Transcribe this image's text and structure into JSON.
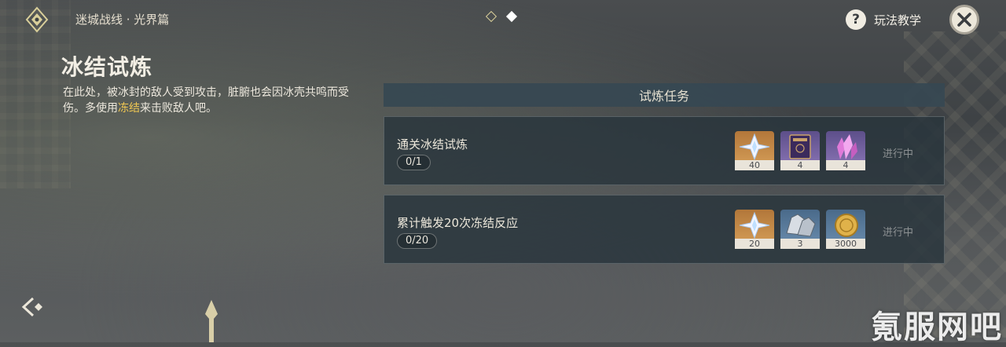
{
  "header": {
    "logo_icon": "diamond-emblem-icon",
    "breadcrumb": "迷城战线 · 光界篇",
    "pager": {
      "count": 2,
      "active": 2
    },
    "help_label": "玩法教学",
    "close_icon": "close-icon"
  },
  "info": {
    "title": "冰结试炼",
    "desc_before": "在此处，被冰封的敌人受到攻击，脏腑也会因冰壳共鸣而受伤。多使用",
    "desc_highlight": "冻结",
    "desc_after": "来击败敌人吧。",
    "highlight_color": "#f0c752"
  },
  "tasks_panel": {
    "header": "试炼任务",
    "tasks": [
      {
        "name": "通关冰结试炼",
        "progress": "0/1",
        "status": "进行中",
        "rewards": [
          {
            "icon": "primogem-icon",
            "count": "40",
            "rarity": "gold"
          },
          {
            "icon": "hero-wit-book-icon",
            "count": "4",
            "rarity": "purple"
          },
          {
            "icon": "mystic-ore-crystal-icon",
            "count": "4",
            "rarity": "purple"
          }
        ]
      },
      {
        "name": "累计触发20次冻结反应",
        "progress": "0/20",
        "status": "进行中",
        "rewards": [
          {
            "icon": "primogem-icon",
            "count": "20",
            "rarity": "gold"
          },
          {
            "icon": "enhancement-ore-icon",
            "count": "3",
            "rarity": "blue"
          },
          {
            "icon": "mora-coin-icon",
            "count": "3000",
            "rarity": "blue"
          }
        ]
      }
    ]
  },
  "footer": {
    "back_icon": "back-arrow-icon",
    "watermark": "氪服网吧"
  }
}
